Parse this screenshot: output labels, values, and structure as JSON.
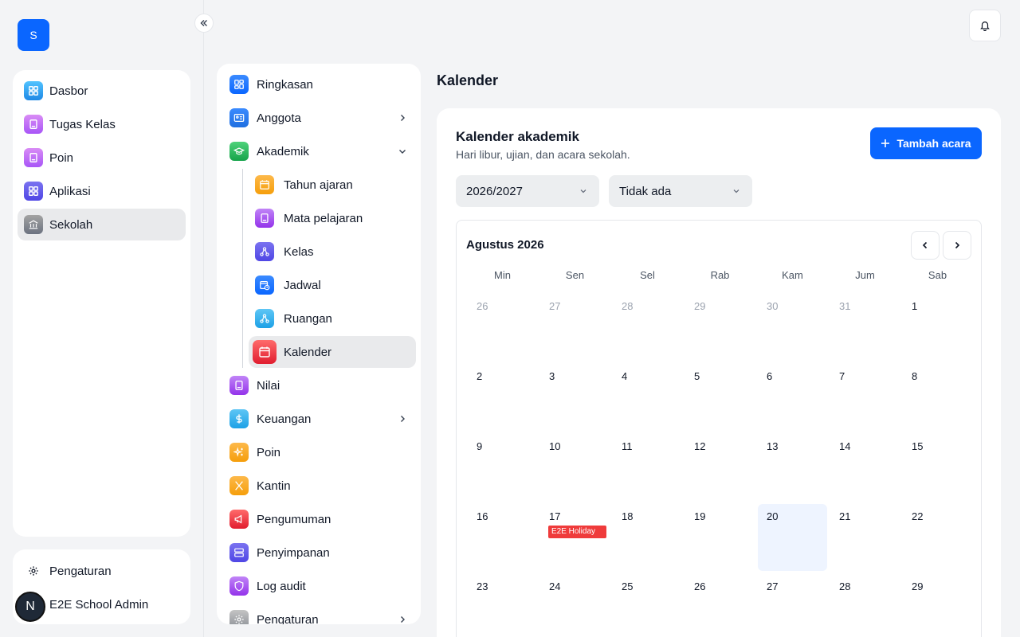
{
  "app": {
    "logo_letter": "S"
  },
  "sidebar": {
    "items": [
      {
        "label": "Dasbor",
        "icon": "grid-icon",
        "color": "#2aa7f0"
      },
      {
        "label": "Tugas Kelas",
        "icon": "book-icon",
        "color": "#b15be6"
      },
      {
        "label": "Poin",
        "icon": "book-icon",
        "color": "#b15be6"
      },
      {
        "label": "Aplikasi",
        "icon": "grid-icon",
        "color": "#5a4fe0"
      },
      {
        "label": "Sekolah",
        "icon": "bank-icon",
        "color": "#6b7280"
      }
    ],
    "settings_label": "Pengaturan",
    "user_name": "E2E School Admin",
    "user_initial": "N"
  },
  "subnav": {
    "items": [
      {
        "label": "Ringkasan",
        "color": "#0a66ff"
      },
      {
        "label": "Anggota",
        "color": "#1f7ae0"
      },
      {
        "label": "Akademik",
        "color": "#22b14c"
      },
      {
        "label": "Tahun ajaran",
        "color": "#f59e0b"
      },
      {
        "label": "Mata pelajaran",
        "color": "#a855f7"
      },
      {
        "label": "Kelas",
        "color": "#5b4fe0"
      },
      {
        "label": "Jadwal",
        "color": "#0a66ff"
      },
      {
        "label": "Ruangan",
        "color": "#29a8e8"
      },
      {
        "label": "Kalender",
        "color": "#ef3b3b"
      },
      {
        "label": "Nilai",
        "color": "#a855f7"
      },
      {
        "label": "Keuangan",
        "color": "#29a8e8"
      },
      {
        "label": "Poin",
        "color": "#f59e0b"
      },
      {
        "label": "Kantin",
        "color": "#f59e0b"
      },
      {
        "label": "Pengumuman",
        "color": "#ef3b3b"
      },
      {
        "label": "Penyimpanan",
        "color": "#5b4fe0"
      },
      {
        "label": "Log audit",
        "color": "#a855f7"
      },
      {
        "label": "Pengaturan",
        "color": "#9ca3af"
      }
    ]
  },
  "main": {
    "page_title": "Kalender",
    "card_title": "Kalender akademik",
    "card_subtitle": "Hari libur, ujian, dan acara sekolah.",
    "add_button": "Tambah acara",
    "year_select": "2026/2027",
    "class_select": "Tidak ada",
    "month_label": "Agustus 2026",
    "weekdays": [
      "Min",
      "Sen",
      "Sel",
      "Rab",
      "Kam",
      "Jum",
      "Sab"
    ],
    "weeks": [
      [
        {
          "d": "26",
          "m": true
        },
        {
          "d": "27",
          "m": true
        },
        {
          "d": "28",
          "m": true
        },
        {
          "d": "29",
          "m": true
        },
        {
          "d": "30",
          "m": true
        },
        {
          "d": "31",
          "m": true
        },
        {
          "d": "1"
        }
      ],
      [
        {
          "d": "2"
        },
        {
          "d": "3"
        },
        {
          "d": "4"
        },
        {
          "d": "5"
        },
        {
          "d": "6"
        },
        {
          "d": "7"
        },
        {
          "d": "8"
        }
      ],
      [
        {
          "d": "9"
        },
        {
          "d": "10"
        },
        {
          "d": "11"
        },
        {
          "d": "12"
        },
        {
          "d": "13"
        },
        {
          "d": "14"
        },
        {
          "d": "15"
        }
      ],
      [
        {
          "d": "16"
        },
        {
          "d": "17",
          "event": "E2E Holiday"
        },
        {
          "d": "18"
        },
        {
          "d": "19"
        },
        {
          "d": "20",
          "today": true
        },
        {
          "d": "21"
        },
        {
          "d": "22"
        }
      ],
      [
        {
          "d": "23"
        },
        {
          "d": "24"
        },
        {
          "d": "25"
        },
        {
          "d": "26"
        },
        {
          "d": "27"
        },
        {
          "d": "28"
        },
        {
          "d": "29"
        }
      ]
    ]
  }
}
